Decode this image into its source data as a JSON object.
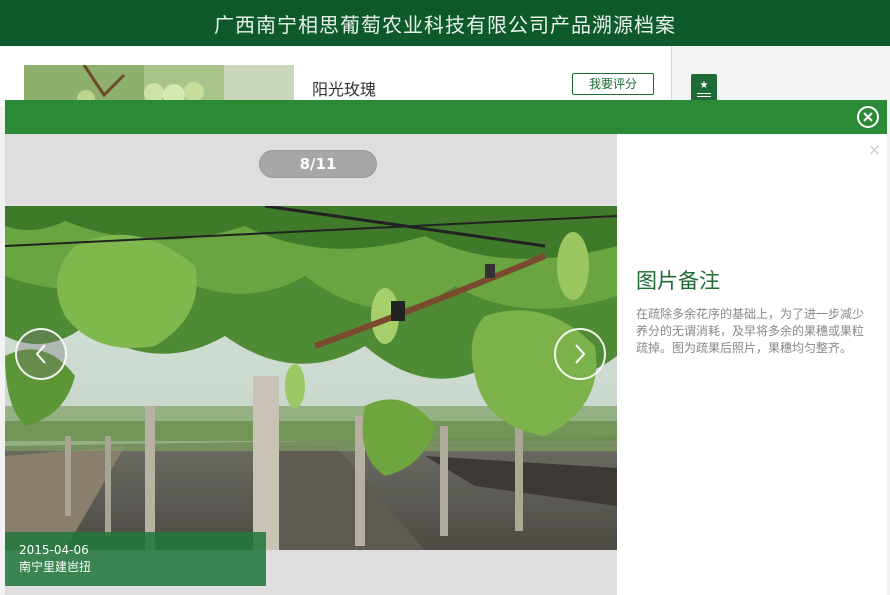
{
  "header": {
    "title": "广西南宁相思葡萄农业科技有限公司产品溯源档案"
  },
  "product": {
    "name": "阳光玫瑰",
    "rate_label": "我要评分"
  },
  "viewer": {
    "counter": "8/11",
    "caption_date": "2015-04-06",
    "caption_place": "南宁里建岜扭"
  },
  "notes": {
    "title": "图片备注",
    "body": "在疏除多余花序的基础上，为了进一步减少养分的无谓消耗，及早将多余的果穗或果粒疏掉。图为疏果后照片，果穗均匀整齐。"
  },
  "colors": {
    "header_bg": "#0f5a2b",
    "modal_bar": "#2b8a35",
    "accent_green": "#1f6b36"
  },
  "icons": {
    "close": "close-circle-icon",
    "prev": "chevron-left-icon",
    "next": "chevron-right-icon",
    "badge": "star-badge-icon"
  }
}
